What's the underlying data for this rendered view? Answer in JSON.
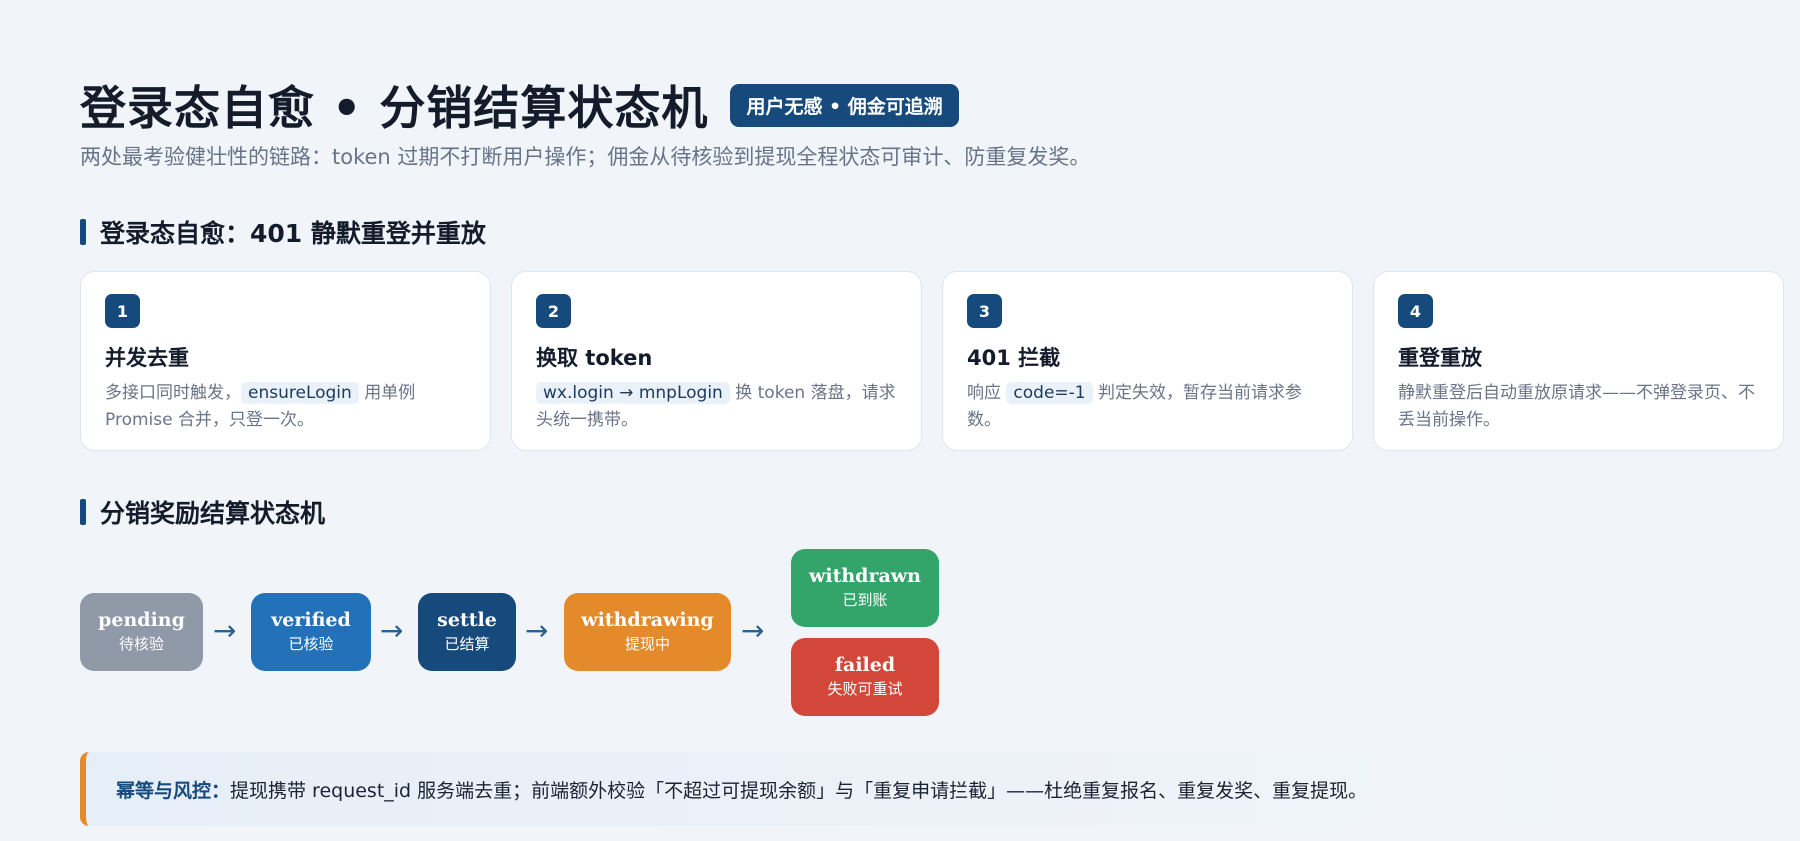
{
  "header": {
    "title": "登录态自愈 • 分销结算状态机",
    "badge": "用户无感 • 佣金可追溯",
    "subtitle": "两处最考验健壮性的链路：token 过期不打断用户操作；佣金从待核验到提现全程状态可审计、防重复发奖。"
  },
  "section_login": {
    "title": "登录态自愈：401 静默重登并重放",
    "cards": [
      {
        "num": "1",
        "title": "并发去重",
        "desc_a": "多接口同时触发，",
        "code": "ensureLogin",
        "desc_b": " 用单例 Promise 合并，只登一次。"
      },
      {
        "num": "2",
        "title": "换取 token",
        "desc_a": "",
        "code": "wx.login → mnpLogin",
        "desc_b": " 换 token 落盘，请求头统一携带。"
      },
      {
        "num": "3",
        "title": "401 拦截",
        "desc_a": "响应 ",
        "code": "code=-1",
        "desc_b": " 判定失效，暂存当前请求参数。"
      },
      {
        "num": "4",
        "title": "重登重放",
        "desc_a": "静默重登后自动重放原请求——不弹登录页、不丢当前操作。",
        "code": "",
        "desc_b": ""
      }
    ]
  },
  "section_state": {
    "title": "分销奖励结算状态机",
    "arrow_glyph": "→",
    "nodes": [
      {
        "en": "pending",
        "zh": "待核验",
        "color": "#8f99a8"
      },
      {
        "en": "verified",
        "zh": "已核验",
        "color": "#2371b9"
      },
      {
        "en": "settle",
        "zh": "已结算",
        "color": "#174a7c"
      },
      {
        "en": "withdrawing",
        "zh": "提现中",
        "color": "#e48a2b"
      },
      {
        "en": "withdrawn",
        "zh": "已到账",
        "color": "#33a56b"
      },
      {
        "en": "failed",
        "zh": "失败可重试",
        "color": "#d3473b"
      }
    ]
  },
  "risk": {
    "label": "幂等与风控：",
    "text": "提现携带 request_id 服务端去重；前端额外校验「不超过可提现余额」与「重复申请拦截」——杜绝重复报名、重复发奖、重复提现。"
  }
}
